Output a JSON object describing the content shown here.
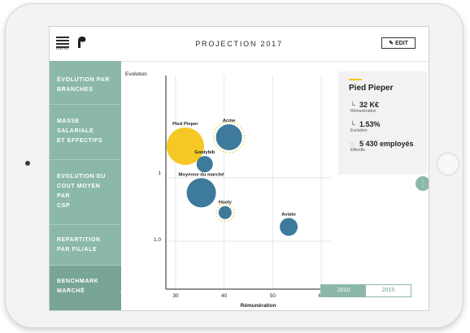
{
  "header": {
    "menu_label": "MENU",
    "title": "PROJECTION 2017",
    "edit_label": "EDIT"
  },
  "sidebar": {
    "items": [
      {
        "lines": [
          "ÉVOLUTION PAR",
          "BRANCHES"
        ]
      },
      {
        "lines": [
          "MASSE",
          "SALARIALE",
          "ET EFFECTIFS"
        ]
      },
      {
        "lines": [
          "EVOLUTION DU",
          "COUT MOYEN",
          "PAR",
          "CSP"
        ]
      },
      {
        "lines": [
          "REPARTITION",
          "PAR FILIALE"
        ]
      },
      {
        "lines": [
          "BENCHMARK",
          "MARCHÉ"
        ],
        "active": true
      }
    ]
  },
  "chart_data": {
    "type": "scatter",
    "ylabel": "Evolution",
    "xlabel": "Rémunération",
    "x_ticks": [
      "30",
      "40",
      "50",
      "60"
    ],
    "y_ticks": [
      "1.0"
    ],
    "xlim": [
      28,
      62
    ],
    "points": [
      {
        "name": "Pied Pieper",
        "x": 32,
        "y": 1.53,
        "size": 23,
        "highlight": true
      },
      {
        "name": "Acme",
        "x": 41,
        "y": 1.58,
        "size": 16,
        "ring": true
      },
      {
        "name": "Goolybib",
        "x": 36,
        "y": 1.43,
        "size": 10
      },
      {
        "name": "Moyenne du marché",
        "x": 35.3,
        "y": 1.27,
        "size": 18
      },
      {
        "name": "Hooly",
        "x": 40.2,
        "y": 1.16,
        "size": 8,
        "ring": true
      },
      {
        "name": "Aviato",
        "x": 53.3,
        "y": 1.08,
        "size": 11
      }
    ]
  },
  "card": {
    "title": "Pied Pieper",
    "stats": [
      {
        "icon": "└",
        "value": "32 K€",
        "label": "Rémunération"
      },
      {
        "icon": "└",
        "value": "1.53%",
        "label": "Evolution"
      },
      {
        "icon": "◌",
        "value": "5 430 employés",
        "label": "Effectifs"
      }
    ]
  },
  "years": {
    "y1": "2010",
    "y2": "2015"
  },
  "colors": {
    "accent": "#8bb8ab",
    "bubble": "#3d7a9b",
    "highlight": "#f5c518"
  }
}
